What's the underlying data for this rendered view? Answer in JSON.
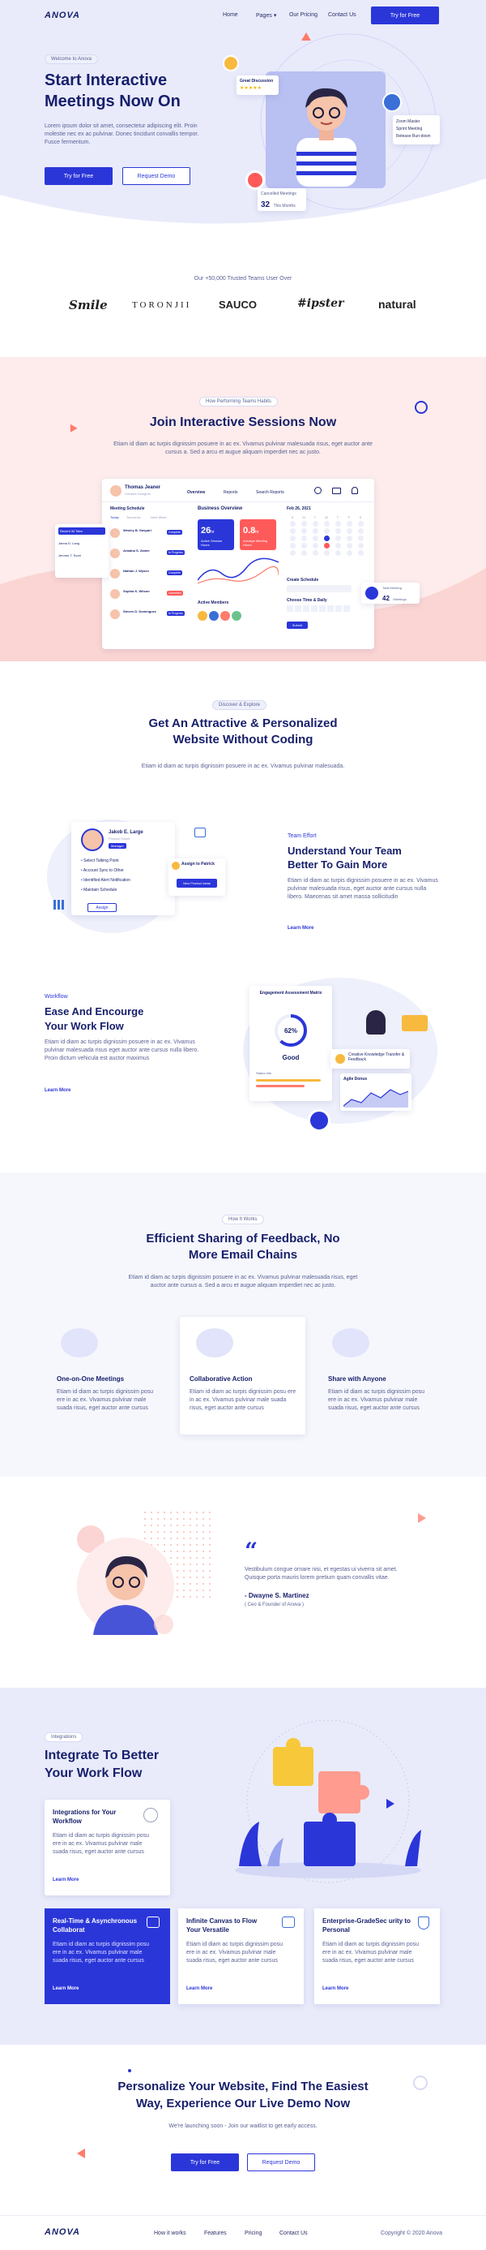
{
  "nav": {
    "logo": "ANOVA",
    "items": [
      "Home",
      "Pages",
      "Our Pricing",
      "Contact Us"
    ],
    "cta": "Try for Free"
  },
  "hero": {
    "badge": "Welcome to Anova",
    "title1": "Start Interactive",
    "title2": "Meetings Now On",
    "desc": "Lorem ipsum dolor sit amet, consectetur adipiscing elit. Proin molestie nec ex ac pulvinar. Donec tincidunt convallis tempor. Fusce fermentum.",
    "btn1": "Try for Free",
    "btn2": "Request Demo",
    "card_top": "Great Discussion",
    "stars": "★★★★★",
    "card_right": [
      "Zoom Master",
      "Sprint Meeting",
      "Release Run-down"
    ],
    "cancel_label": "Cancelled Meetings",
    "cancel_num": "32",
    "cancel_unit": "This Months"
  },
  "trusted": {
    "label": "Our +50,000 Trusted Teams User Over",
    "logos": [
      "Smile",
      "TORONJII",
      "SAUCO",
      "#ipster",
      "natural"
    ]
  },
  "sessions": {
    "badge": "How Performing Teams Habits",
    "title": "Join Interactive Sessions Now",
    "desc": "Etiam id diam ac turpis dignissim posuere in ac ex. Vivamus pulvinar malesuada risus, eget auctor ante cursus a. Sed a arcu et augue aliquam imperdiet nec ac justo.",
    "dash": {
      "user": "Thomas Jeaner",
      "user_role": "Creative Designer",
      "tabs": [
        "Overview",
        "Reports",
        "Search Reports"
      ],
      "schedule_title": "Meeting Schedule",
      "schedule_tabs": [
        "Today",
        "Tomorrow",
        "Next Week"
      ],
      "people": [
        "Wesley B. Gaspari",
        "Ariadna S. Zamer",
        "Nathan J. Wysen",
        "Sophia K. Wilson",
        "Steven D. Dominguez"
      ],
      "people_status": [
        "Complete",
        "In Progress",
        "Complete",
        "Cancelled",
        "In Progress"
      ],
      "overview": "Business Overview",
      "stat1": "26",
      "stat1_unit": "hr",
      "stat1_label": "Active Session Hours",
      "stat2": "0.8",
      "stat2_unit": "hr",
      "stat2_label": "Average Meeting Hours",
      "active": "Active Members",
      "date": "Feb 26, 2021",
      "days": [
        "S",
        "M",
        "T",
        "W",
        "T",
        "F",
        "S"
      ],
      "create": "Create Schedule",
      "choose": "Choose Time & Daily",
      "add_btn": "Submit",
      "mini_title": "Recent 30 Tabs",
      "mini_rows": [
        "Janna D. Lang",
        "Jerome T. Scott"
      ],
      "badge_title": "Total Meeting",
      "badge_num": "42",
      "badge_unit": "Meetings"
    }
  },
  "attractive": {
    "badge": "Discover & Explore",
    "title1": "Get An Attractive & Personalized",
    "title2": "Website Without Coding",
    "desc": "Etiam id diam ac turpis dignissim posuere in ac ex. Vivamus pulvinar malesuada."
  },
  "team": {
    "label": "Team Effort",
    "title1": "Understand Your Team",
    "title2": "Better To Gain More",
    "desc": "Etiam id diam ac turpis dignissim posuere in ac ex. Vivamus pulvinar malesuada risus, eget auctor ante cursus nulla libero. Maecenas sit amet massa sollicitudin",
    "link": "Learn More",
    "card_name": "Jakob E. Large",
    "card_role": "Product Owner",
    "card_tag": "Manager",
    "list": [
      "Select Talking Point",
      "Account Sync to Other",
      "Identified Alert Notification",
      "Maintain Schedule"
    ],
    "assign": "Assign",
    "assign2": "Assign to Patrick",
    "assign2_btn": "New Product Ideas"
  },
  "workflow": {
    "label": "Workflow",
    "title1": "Ease And Encourge",
    "title2": "Your Work Flow",
    "desc": "Etiam id diam ac turpis dignissim posuere in ac ex. Vivamus pulvinar malesuada risus eget auctor ante cursus nulla libero. Proin dictum vehicula est auctor maximus",
    "link": "Learn More",
    "eng_title": "Engagement Assessment Matrix",
    "eng_pct": "62%",
    "eng_good": "Good",
    "status_label": "Status Info",
    "creative": "Creative Knowledge Transfer & Feedback",
    "agile": "Agile Donus"
  },
  "feedback": {
    "badge": "How It Works",
    "title1": "Efficient Sharing of Feedback, No",
    "title2": "More Email Chains",
    "desc": "Etiam id diam ac turpis dignissim posuere in ac ex. Vivamus pulvinar malesuada risus, eget auctor ante cursus a. Sed a arcu et augue aliquam imperdiet nec ac justo.",
    "items": [
      {
        "title": "One-on-One Meetings",
        "desc": "Etiam id diam ac turpis dignissim posu ere in ac ex. Vivamus pulvinar male suada risus, eget auctor ante cursus"
      },
      {
        "title": "Collaborative Action",
        "desc": "Etiam id diam ac turpis dignissim posu ere in ac ex. Vivamus pulvinar male suada risus, eget auctor ante cursus"
      },
      {
        "title": "Share with Anyone",
        "desc": "Etiam id diam ac turpis dignissim posu ere in ac ex. Vivamus pulvinar male suada risus, eget auctor ante cursus"
      }
    ]
  },
  "testimonial": {
    "quote": "Vestibulum congue ornare nisi, et egestas ui viverra sit amet. Quisque porta mauris lorem pretium quam convallis vitae.",
    "name": "- Dwayne S. Martinez",
    "role": "( Ceo & Founder of Anova )"
  },
  "integrations": {
    "badge": "Integrations",
    "title1": "Integrate To Better",
    "title2": "Your Work Flow",
    "card1_title": "Integrations for Your Workflow",
    "card1_desc": "Etiam id diam ac turpis dignissim posu ere in ac ex. Vivamus pulvinar male suada risus, eget auctor ante cursus",
    "link": "Learn More",
    "cards": [
      {
        "title": "Real-Time & Asynchronous Collaborat",
        "desc": "Etiam id diam ac turpis dignissim posu ere in ac ex. Vivamus pulvinar male suada risus, eget auctor ante cursus"
      },
      {
        "title": "Infinite Canvas to Flow Your Versatile",
        "desc": "Etiam id diam ac turpis dignissim posu ere in ac ex. Vivamus pulvinar male suada risus, eget auctor ante cursus"
      },
      {
        "title": "Enterprise-GradeSec urity to Personal",
        "desc": "Etiam id diam ac turpis dignissim posu ere in ac ex. Vivamus pulvinar male suada risus, eget auctor ante cursus"
      }
    ]
  },
  "cta": {
    "title1": "Personalize Your Website, Find The Easiest",
    "title2": "Way, Experience Our Live Demo Now",
    "desc": "We're launching soon - Join our waitlist to get early access.",
    "btn1": "Try for Free",
    "btn2": "Request Demo"
  },
  "footer": {
    "logo": "ANOVA",
    "links": [
      "How it works",
      "Features",
      "Pricing",
      "Contact Us"
    ],
    "copy": "Copyright © 2020 Anova"
  },
  "colors": {
    "primary": "#2b36d9",
    "navy": "#171f6b",
    "pink": "#fde8e6",
    "lavender": "#e9ebfb"
  }
}
